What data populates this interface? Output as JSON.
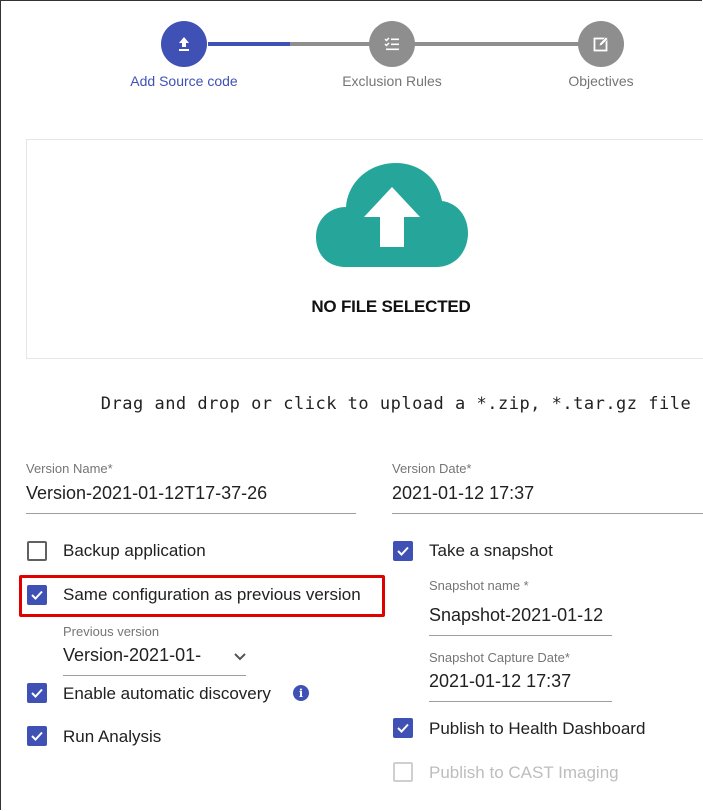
{
  "stepper": {
    "steps": [
      {
        "label": "Add Source code",
        "icon": "upload-icon",
        "state": "active"
      },
      {
        "label": "Exclusion Rules",
        "icon": "checklist-icon",
        "state": "inactive"
      },
      {
        "label": "Objectives",
        "icon": "edit-icon",
        "state": "inactive"
      }
    ],
    "active_color": "#3f51b5",
    "inactive_color": "#8e8e8e"
  },
  "upload": {
    "status": "NO FILE SELECTED",
    "instructions": "Drag and drop or click to upload a *.zip, *.tar.gz file",
    "icon": "cloud-upload-icon",
    "icon_color": "#26a69a"
  },
  "form": {
    "version_name": {
      "label": "Version Name*",
      "value": "Version-2021-01-12T17-37-26"
    },
    "version_date": {
      "label": "Version Date*",
      "value": "2021-01-12 17:37"
    },
    "backup_application": {
      "label": "Backup application",
      "checked": false
    },
    "same_configuration": {
      "label": "Same configuration as previous version",
      "checked": true
    },
    "previous_version": {
      "label": "Previous version",
      "value": "Version-2021-01-"
    },
    "enable_discovery": {
      "label": "Enable automatic discovery",
      "checked": true
    },
    "run_analysis": {
      "label": "Run Analysis",
      "checked": true
    },
    "take_snapshot": {
      "label": "Take a snapshot",
      "checked": true
    },
    "snapshot_name": {
      "label": "Snapshot name *",
      "value": "Snapshot-2021-01-12"
    },
    "snapshot_date": {
      "label": "Snapshot Capture Date*",
      "value": "2021-01-12 17:37"
    },
    "publish_health": {
      "label": "Publish to Health Dashboard",
      "checked": true
    },
    "publish_imaging": {
      "label": "Publish to CAST Imaging",
      "checked": false,
      "disabled": true
    }
  },
  "highlight_color": "#e00000"
}
